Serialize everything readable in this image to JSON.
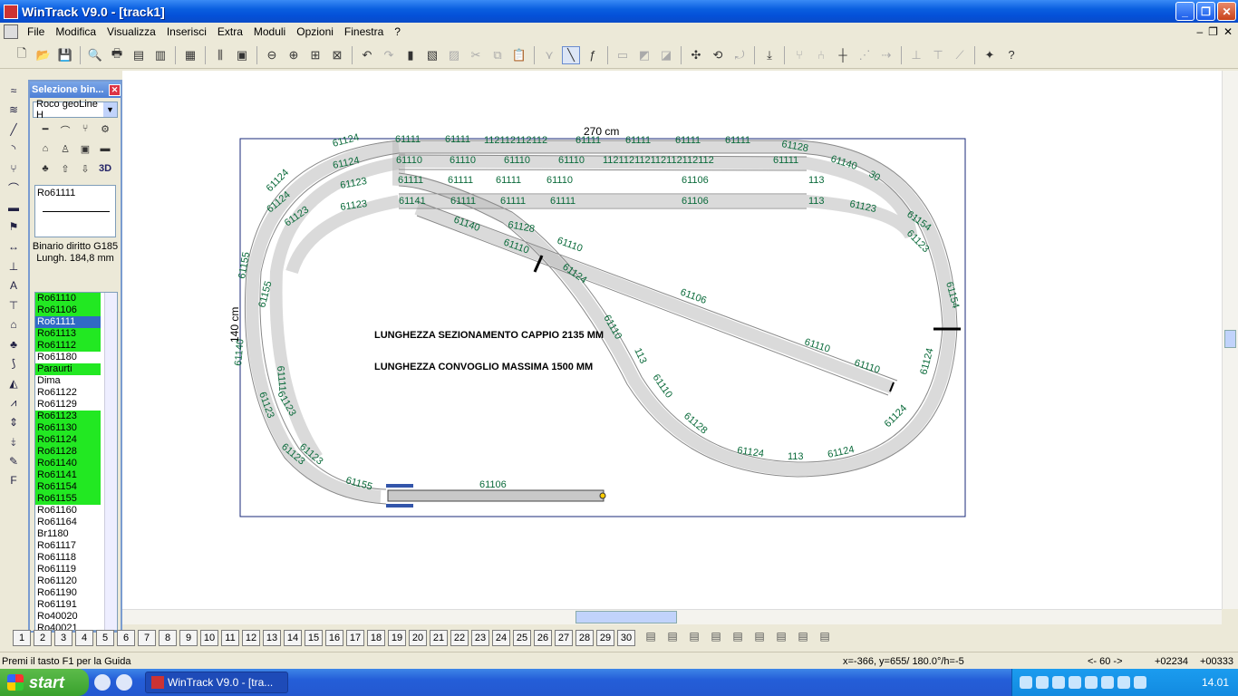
{
  "window": {
    "title": "WinTrack  V9.0 - [track1]"
  },
  "menu": [
    "File",
    "Modifica",
    "Visualizza",
    "Inserisci",
    "Extra",
    "Moduli",
    "Opzioni",
    "Finestra",
    "?"
  ],
  "panel": {
    "title": "Selezione bin...",
    "brand": "Roco geoLine H",
    "preview_code": "Ro61111",
    "description_line1": "Binario diritto G185",
    "description_line2": "Lungh. 184,8 mm",
    "items": [
      {
        "label": "Ro61110",
        "state": "green"
      },
      {
        "label": "Ro61106",
        "state": "green"
      },
      {
        "label": "Ro61111",
        "state": "selected"
      },
      {
        "label": "Ro61113",
        "state": "green"
      },
      {
        "label": "Ro61112",
        "state": "green"
      },
      {
        "label": "Ro61180",
        "state": "normal"
      },
      {
        "label": "Paraurti",
        "state": "green"
      },
      {
        "label": "Dima",
        "state": "normal"
      },
      {
        "label": "Ro61122",
        "state": "normal"
      },
      {
        "label": "Ro61129",
        "state": "normal"
      },
      {
        "label": "Ro61123",
        "state": "green"
      },
      {
        "label": "Ro61130",
        "state": "green"
      },
      {
        "label": "Ro61124",
        "state": "green"
      },
      {
        "label": "Ro61128",
        "state": "green"
      },
      {
        "label": "Ro61140",
        "state": "green"
      },
      {
        "label": "Ro61141",
        "state": "green"
      },
      {
        "label": "Ro61154",
        "state": "green"
      },
      {
        "label": "Ro61155",
        "state": "green"
      },
      {
        "label": "Ro61160",
        "state": "normal"
      },
      {
        "label": "Ro61164",
        "state": "normal"
      },
      {
        "label": "Br1180",
        "state": "normal"
      },
      {
        "label": "Ro61117",
        "state": "normal"
      },
      {
        "label": "Ro61118",
        "state": "normal"
      },
      {
        "label": "Ro61119",
        "state": "normal"
      },
      {
        "label": "Ro61120",
        "state": "normal"
      },
      {
        "label": "Ro61190",
        "state": "normal"
      },
      {
        "label": "Ro61191",
        "state": "normal"
      },
      {
        "label": "Ro40020",
        "state": "normal"
      },
      {
        "label": "Ro40021",
        "state": "normal"
      }
    ]
  },
  "layout": {
    "width_label": "270 cm",
    "height_label": "140 cm",
    "note1": "LUNGHEZZA SEZIONAMENTO CAPPIO 2135 MM",
    "note2": "LUNGHEZZA CONVOGLIO MASSIMA 1500 MM",
    "siding_label": "61106"
  },
  "pages": [
    "1",
    "2",
    "3",
    "4",
    "5",
    "6",
    "7",
    "8",
    "9",
    "10",
    "11",
    "12",
    "13",
    "14",
    "15",
    "16",
    "17",
    "18",
    "19",
    "20",
    "21",
    "22",
    "23",
    "24",
    "25",
    "26",
    "27",
    "28",
    "29",
    "30"
  ],
  "status": {
    "help": "Premi il tasto F1 per la Guida",
    "coords": "x=-366, y=655/ 180.0°/h=-5",
    "scale": "<- 60 ->",
    "n1": "+02234",
    "n2": "+00333"
  },
  "taskbar": {
    "start": "start",
    "task": "WinTrack  V9.0 - [tra...",
    "clock": "14.01"
  }
}
